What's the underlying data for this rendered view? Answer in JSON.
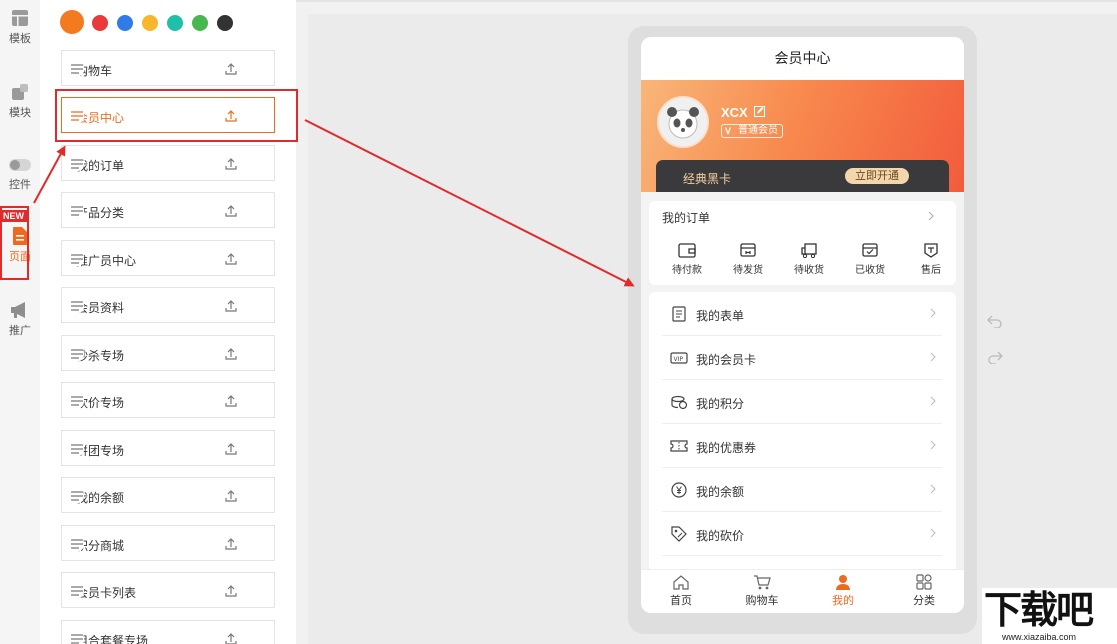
{
  "rail": {
    "items": [
      {
        "label": "模板",
        "icon": "template-icon"
      },
      {
        "label": "模块",
        "icon": "module-icon"
      },
      {
        "label": "控件",
        "icon": "toggle-icon"
      },
      {
        "label": "页面",
        "icon": "page-icon",
        "badge": "NEW",
        "active": true
      },
      {
        "label": "推广",
        "icon": "megaphone-icon"
      }
    ]
  },
  "swatches": [
    "#f47a20",
    "#e83a3a",
    "#2f7bea",
    "#f7b62b",
    "#1fbfa9",
    "#47b84d",
    "#333333"
  ],
  "pages": [
    {
      "label": "购物车"
    },
    {
      "label": "会员中心",
      "active": true
    },
    {
      "label": "我的订单"
    },
    {
      "label": "产品分类"
    },
    {
      "label": "推广员中心"
    },
    {
      "label": "会员资料"
    },
    {
      "label": "秒杀专场"
    },
    {
      "label": "砍价专场"
    },
    {
      "label": "拼团专场"
    },
    {
      "label": "我的余额"
    },
    {
      "label": "积分商城"
    },
    {
      "label": "会员卡列表"
    },
    {
      "label": "组合套餐专场"
    }
  ],
  "phone": {
    "title": "会员中心",
    "user": {
      "name": "XCX",
      "level_badge": "V",
      "level": "普通会员"
    },
    "black_card": {
      "label": "经典黑卡",
      "button": "立即开通"
    },
    "orders": {
      "title": "我的订单",
      "items": [
        {
          "label": "待付款",
          "icon": "wallet-icon"
        },
        {
          "label": "待发货",
          "icon": "box-icon"
        },
        {
          "label": "待收货",
          "icon": "truck-icon"
        },
        {
          "label": "已收货",
          "icon": "check-box-icon"
        },
        {
          "label": "售后",
          "icon": "after-sale-icon"
        }
      ]
    },
    "menu": [
      {
        "label": "我的表单",
        "icon": "form-icon"
      },
      {
        "label": "我的会员卡",
        "icon": "vip-card-icon"
      },
      {
        "label": "我的积分",
        "icon": "coins-icon"
      },
      {
        "label": "我的优惠券",
        "icon": "coupon-icon"
      },
      {
        "label": "我的余额",
        "icon": "yuan-icon"
      },
      {
        "label": "我的砍价",
        "icon": "price-tag-icon"
      }
    ],
    "tabs": [
      {
        "label": "首页",
        "icon": "home-icon"
      },
      {
        "label": "购物车",
        "icon": "cart-icon"
      },
      {
        "label": "我的",
        "icon": "person-icon",
        "active": true
      },
      {
        "label": "分类",
        "icon": "grid-icon"
      }
    ]
  },
  "watermark": {
    "text": "下载吧",
    "url": "www.xiazaiba.com"
  },
  "colors": {
    "accent": "#ee6b1e",
    "annotation": "#e12a2a"
  }
}
